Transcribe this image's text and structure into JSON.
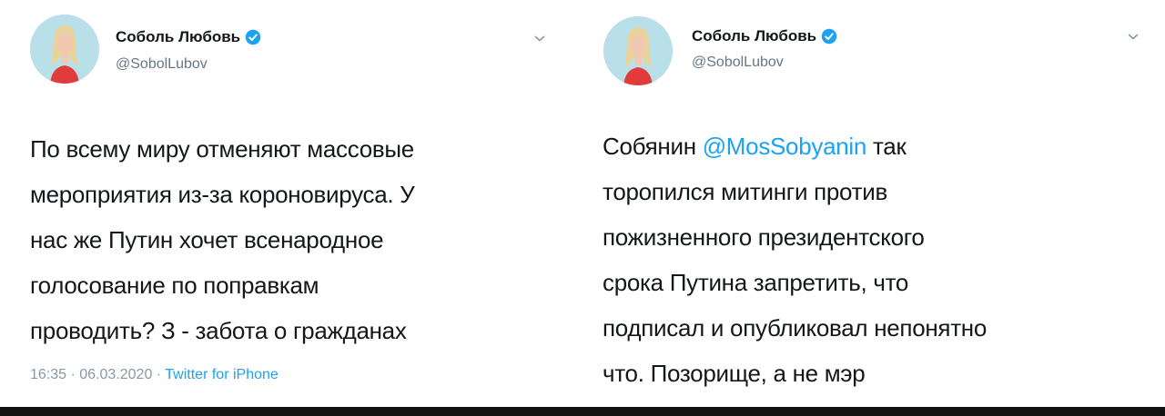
{
  "tweets": [
    {
      "author": {
        "name": "Соболь Любовь",
        "handle": "@SobolLubov",
        "verified": true
      },
      "text_lines": [
        "По всему миру отменяют массовые",
        "мероприятия из-за короновируса. У",
        "нас же Путин хочет всенародное",
        "голосование по поправкам",
        "проводить? З - забота о гражданах"
      ],
      "meta": {
        "time": "16:35",
        "separator": " · ",
        "date": "06.03.2020",
        "source": "Twitter for iPhone"
      }
    },
    {
      "author": {
        "name": "Соболь Любовь",
        "handle": "@SobolLubov",
        "verified": true
      },
      "text_first_line": {
        "prefix": "Собянин ",
        "mention": "@MosSobyanin",
        "suffix": " так"
      },
      "text_lines": [
        "торопился митинги против",
        "пожизненного президентского",
        "срока Путина запретить, что",
        "подписал и опубликовал непонятно",
        "что. Позорище, а не мэр"
      ]
    }
  ],
  "colors": {
    "text": "#14171a",
    "secondary": "#657786",
    "link": "#1da1f2",
    "verified": "#1da1f2",
    "avatar_bg": "#b9e0e9"
  },
  "icons": {
    "verified": "verified-badge-icon",
    "menu": "chevron-down-icon"
  }
}
